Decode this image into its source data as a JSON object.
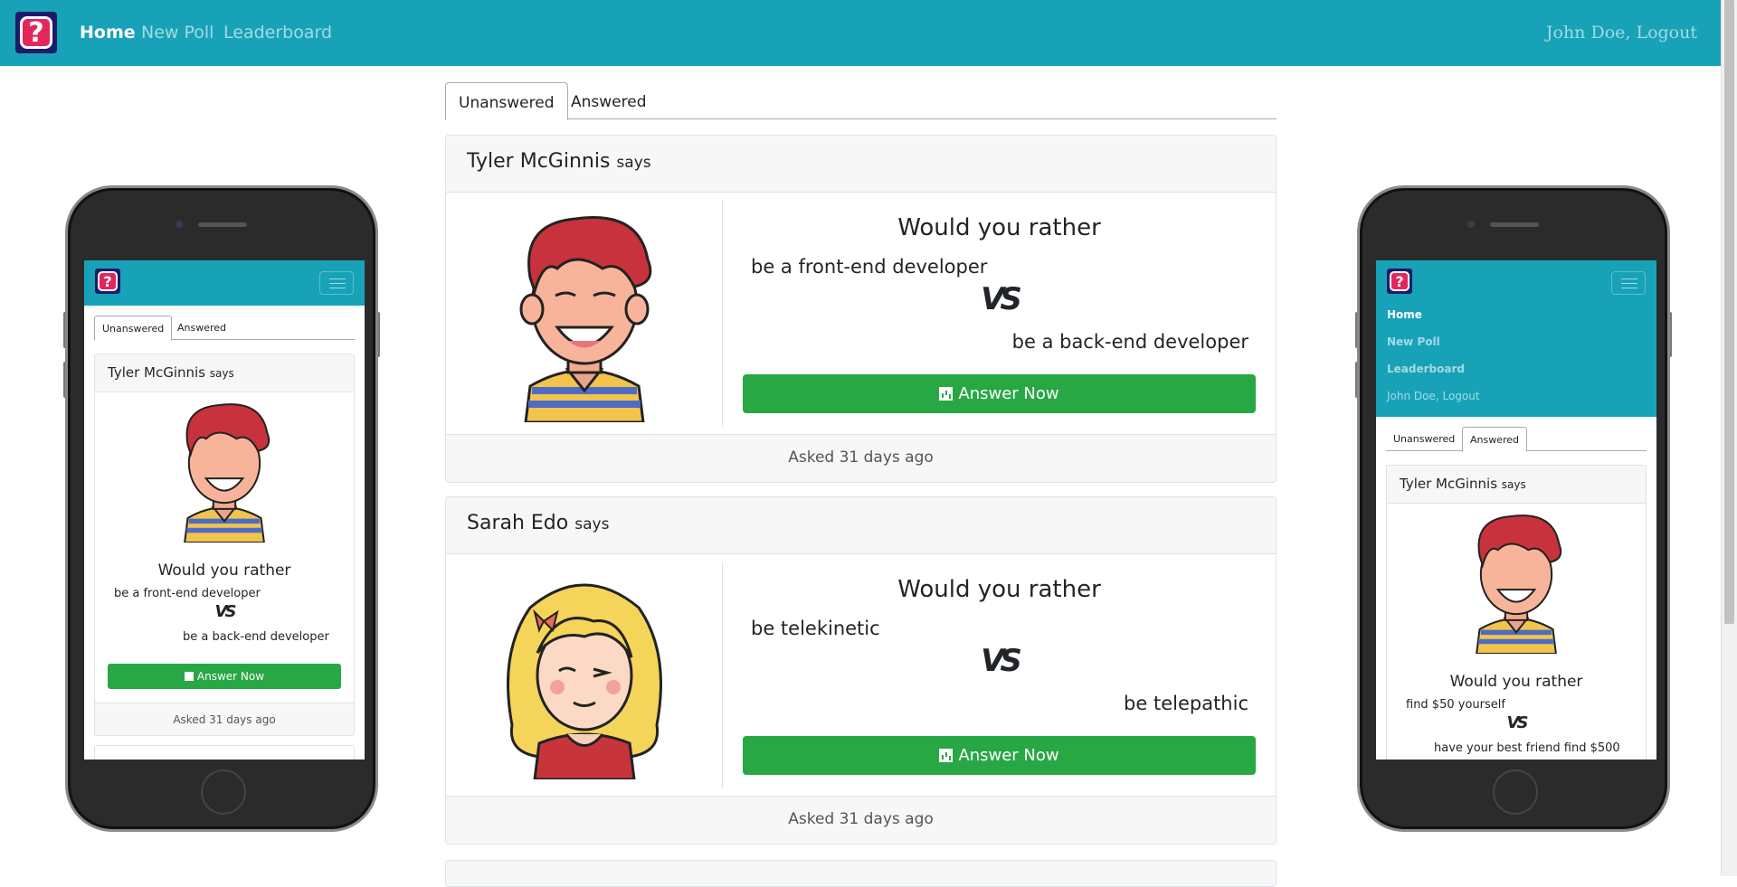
{
  "nav": {
    "links": [
      "Home",
      "New Poll",
      "Leaderboard"
    ],
    "user": "John Doe, Logout"
  },
  "tabs": [
    "Unanswered",
    "Answered"
  ],
  "polls": [
    {
      "author": "Tyler McGinnis",
      "says": "says",
      "title": "Would you rather",
      "option_a": "be a front-end developer",
      "vs": "VS",
      "option_b": "be a back-end developer",
      "button": "Answer Now",
      "footer": "Asked 31 days ago",
      "avatar": "boy-avatar"
    },
    {
      "author": "Sarah Edo",
      "says": "says",
      "title": "Would you rather",
      "option_a": "be telekinetic",
      "vs": "VS",
      "option_b": "be telepathic",
      "button": "Answer Now",
      "footer": "Asked 31 days ago",
      "avatar": "girl-avatar"
    }
  ],
  "phone_left": {
    "tabs": [
      "Unanswered",
      "Answered"
    ],
    "author": "Tyler McGinnis",
    "says": "says",
    "title": "Would you rather",
    "option_a": "be a front-end developer",
    "vs": "VS",
    "option_b": "be a back-end developer",
    "button": "Answer Now",
    "footer": "Asked 31 days ago"
  },
  "phone_right": {
    "menu": [
      "Home",
      "New Poll",
      "Leaderboard",
      "John Doe, Logout"
    ],
    "tabs": [
      "Unanswered",
      "Answered"
    ],
    "author": "Tyler McGinnis",
    "says": "says",
    "title": "Would you rather",
    "option_a": "find $50 yourself",
    "vs": "VS",
    "option_b": "have your best friend find $500"
  },
  "colors": {
    "navbar": "#17a2b8",
    "button": "#28a745",
    "logo_bg": "#1b1b6b",
    "logo_accent": "#e3265c"
  }
}
